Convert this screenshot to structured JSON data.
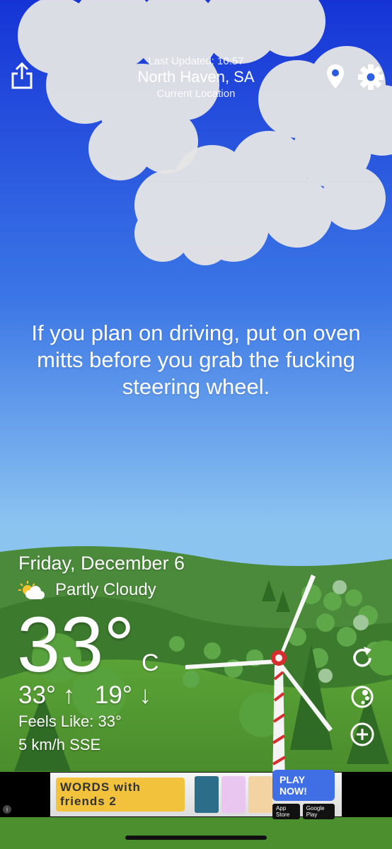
{
  "header": {
    "last_updated": "Last Updated: 10:57",
    "location": "North Haven, SA",
    "location_sub": "Current Location"
  },
  "toolbar": {
    "share_icon": "share-icon",
    "pin_icon": "map-pin-icon",
    "settings_icon": "gear-icon"
  },
  "message": "If you plan on driving, put on oven mitts before you grab the fucking steering wheel.",
  "weather": {
    "date": "Friday, December 6",
    "condition": "Partly Cloudy",
    "condition_icon": "partly-cloudy-icon",
    "temperature": "33°",
    "unit": "C",
    "high": "33° ↑",
    "low": "19° ↓",
    "feels_like": "Feels Like: 33°",
    "wind": "5 km/h SSE"
  },
  "side_buttons": [
    "refresh-icon",
    "moon-icon",
    "add-icon"
  ],
  "ad": {
    "logo_text": "WORDS with friends 2",
    "button": "PLAY NOW!",
    "store_1": "App Store",
    "store_2": "Google Play",
    "info": "i"
  },
  "colors": {
    "sky_top": "#1a3cd8",
    "sky_bottom": "#8fc6f0",
    "grass": "#4b8f2f",
    "ad_button": "#3f6ee5"
  }
}
